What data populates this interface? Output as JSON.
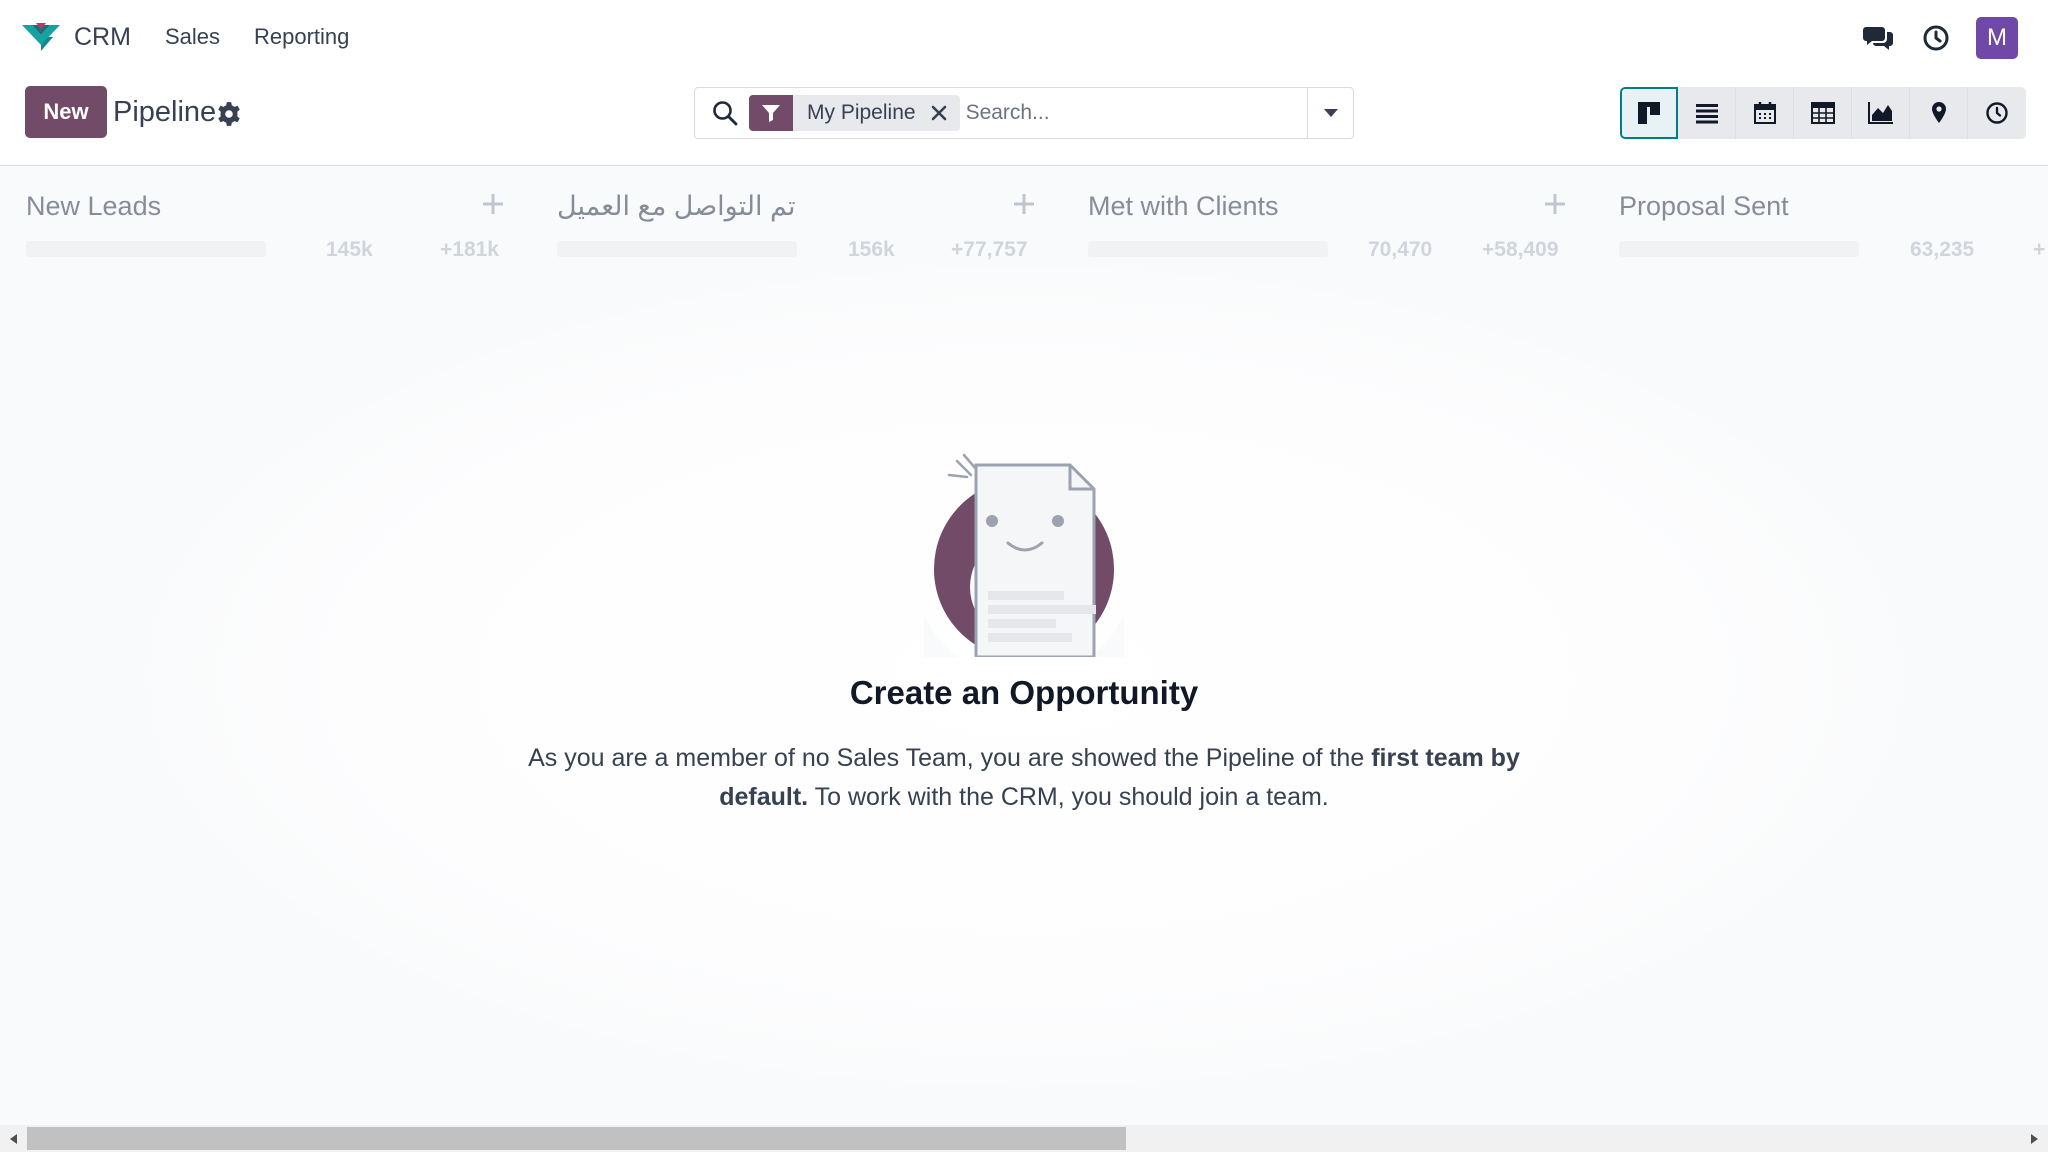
{
  "navbar": {
    "app_name": "CRM",
    "menu": [
      "Sales",
      "Reporting"
    ],
    "avatar_letter": "M",
    "icons": [
      "chat-icon",
      "clock-icon"
    ]
  },
  "control": {
    "new_label": "New",
    "title": "Pipeline",
    "search": {
      "facet_label": "My Pipeline",
      "placeholder": "Search..."
    },
    "views": [
      "kanban",
      "list",
      "calendar",
      "pivot",
      "graph",
      "map",
      "activity"
    ],
    "active_view": "kanban"
  },
  "kanban": {
    "columns": [
      {
        "title": "New Leads",
        "sum": "145k",
        "extra": "+181k"
      },
      {
        "title": "تم التواصل مع العميل",
        "sum": "156k",
        "extra": "+77,757"
      },
      {
        "title": "Met with Clients",
        "sum": "70,470",
        "extra": "+58,409"
      },
      {
        "title": "Proposal Sent",
        "sum": "63,235",
        "extra": "+"
      }
    ]
  },
  "empty_state": {
    "title": "Create an Opportunity",
    "text_part1": "As you are a member of no Sales Team, you are showed the Pipeline of the ",
    "text_bold": "first team by default.",
    "text_part2": " To work with the CRM, you should join a team."
  },
  "colors": {
    "primary": "#714b67",
    "active_view": "#017e84",
    "avatar": "#7048a8"
  }
}
